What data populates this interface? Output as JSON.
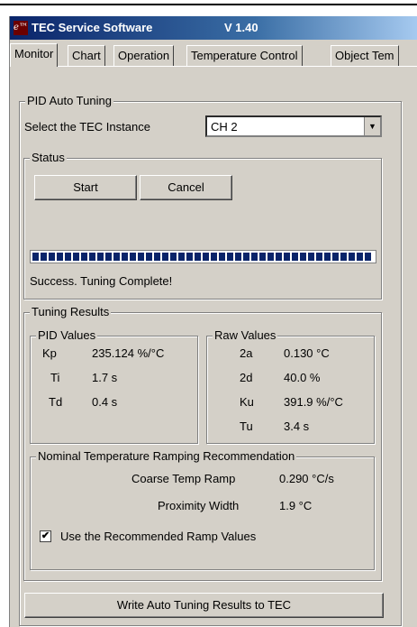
{
  "window": {
    "logo_text": "e™",
    "title": "TEC Service Software",
    "version": "V 1.40"
  },
  "tabs": [
    "Monitor",
    "Chart",
    "Operation",
    "Temperature Control",
    "Object Tem"
  ],
  "selected_tab": "Monitor",
  "pid": {
    "group_label": "PID Auto Tuning",
    "instance_label": "Select the TEC Instance",
    "instance_value": "CH 2",
    "status": {
      "group_label": "Status",
      "start_label": "Start",
      "cancel_label": "Cancel",
      "progress": 1.0,
      "message": "Success. Tuning Complete!"
    },
    "results": {
      "group_label": "Tuning Results",
      "pid_values_label": "PID Values",
      "pid_values": [
        {
          "name": "Kp",
          "value": "235.124 %/°C"
        },
        {
          "name": "Ti",
          "value": "1.7 s"
        },
        {
          "name": "Td",
          "value": "0.4 s"
        }
      ],
      "raw_values_label": "Raw Values",
      "raw_values": [
        {
          "name": "2a",
          "value": "0.130 °C"
        },
        {
          "name": "2d",
          "value": "40.0 %"
        },
        {
          "name": "Ku",
          "value": "391.9 %/°C"
        },
        {
          "name": "Tu",
          "value": "3.4 s"
        }
      ],
      "ramp": {
        "group_label": "Nominal Temperature Ramping Recommendation",
        "coarse_label": "Coarse Temp Ramp",
        "coarse_value": "0.290 °C/s",
        "proximity_label": "Proximity Width",
        "proximity_value": "1.9 °C",
        "use_recommended_label": "Use the Recommended Ramp Values",
        "use_recommended_checked": true
      }
    },
    "write_button_label": "Write Auto Tuning Results to TEC"
  }
}
